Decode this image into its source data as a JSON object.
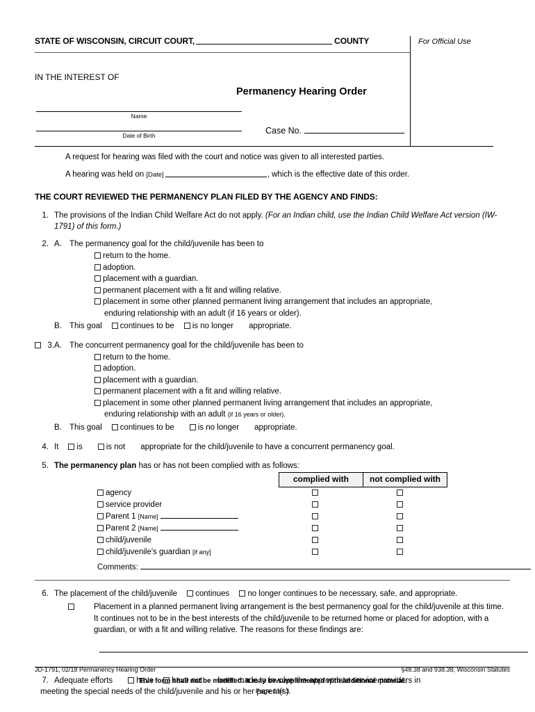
{
  "header": {
    "court_label": "STATE OF WISCONSIN, CIRCUIT COURT,",
    "county_label": "COUNTY",
    "in_the_interest_of": "IN THE INTEREST OF",
    "form_title": "Permanency Hearing Order",
    "name_caption": "Name",
    "dob_caption": "Date of Birth",
    "case_no_label": "Case No.",
    "official_use": "For Official Use"
  },
  "intro": {
    "request": "A request for hearing was filed with the court and notice was given to all interested parties.",
    "hearing_prefix": "A hearing was held on",
    "hearing_date_tag": "[Date]",
    "hearing_suffix": ", which is the effective date of this order."
  },
  "court_finds_heading": "THE COURT REVIEWED THE PERMANENCY PLAN FILED BY THE AGENCY AND FINDS:",
  "items": {
    "i1": {
      "num": "1.",
      "text": "The provisions of the Indian Child Welfare Act do not apply.",
      "italic_note": "(For an Indian child, use the Indian Child Welfare Act version (IW-1791) of this form.)"
    },
    "i2": {
      "num": "2.",
      "sub_a": "A.",
      "a_text": "The permanency goal for the child/juvenile has been to",
      "options": [
        "return to the home.",
        "adoption.",
        "placement with a guardian.",
        "permanent placement with a fit and willing relative.",
        "placement in some other planned permanent living arrangement that includes an appropriate,"
      ],
      "option5_cont": "enduring relationship with an adult (if 16 years or older).",
      "sub_b": "B.",
      "b_prefix": "This goal",
      "b_opt1": "continues to be",
      "b_opt2": "is no longer",
      "b_suffix": "appropriate."
    },
    "i3": {
      "num": "3.",
      "sub_a": "A.",
      "a_text": "The concurrent permanency goal for the child/juvenile has been to",
      "options": [
        "return to the home.",
        "adoption.",
        "placement with a guardian.",
        "permanent placement with a fit and willing relative.",
        "placement in some other planned permanent living arrangement that includes an appropriate,"
      ],
      "option5_cont_main": "enduring relationship with an adult",
      "option5_cont_small": "(if 16 years or older).",
      "sub_b": "B.",
      "b_prefix": "This goal",
      "b_opt1": "continues to be",
      "b_opt2": "is no longer",
      "b_suffix": "appropriate."
    },
    "i4": {
      "num": "4.",
      "prefix": "It",
      "opt1": "is",
      "opt2": "is not",
      "suffix": "appropriate for the child/juvenile to have a concurrent permanency goal."
    },
    "i5": {
      "num": "5.",
      "bold_lead": "The permanency plan",
      "text": "has or has not been complied with as follows:",
      "col_a": "complied with",
      "col_b": "not complied with",
      "rows": [
        {
          "label": "agency",
          "name_tag": "",
          "has_blank": false
        },
        {
          "label": "service provider",
          "name_tag": "",
          "has_blank": false
        },
        {
          "label": "Parent 1",
          "name_tag": "[Name]",
          "has_blank": true
        },
        {
          "label": "Parent 2",
          "name_tag": "[Name]",
          "has_blank": true
        },
        {
          "label": "child/juvenile",
          "name_tag": "",
          "has_blank": false
        },
        {
          "label": "child/juvenile's guardian",
          "name_tag": "[if any]",
          "has_blank": false
        }
      ],
      "comments_label": "Comments:"
    },
    "i6": {
      "num": "6.",
      "prefix": "The placement of the child/juvenile",
      "opt1": "continues",
      "opt2": "no longer continues to be necessary, safe, and appropriate.",
      "paragraph": "Placement in a planned permanent living arrangement is the best permanency goal for the child/juvenile at this time. It continues not to be in the best interests of the child/juvenile to be returned home or placed for adoption, with a guardian, or with a fit and willing relative. The reasons for these findings are:"
    },
    "i7": {
      "num": "7.",
      "prefix": "Adequate efforts",
      "opt1": "have",
      "opt2": "have not",
      "suffix": "been made to involve the appropriate service providers in",
      "line2": "meeting the special needs of the child/juvenile and his or her parent(s)."
    }
  },
  "footer": {
    "left": "JD-1791, 02/18  Permanency Hearing Order",
    "right": "§48.38 and 938.38, Wisconsin Statutes",
    "center": "This form shall not be modified. It may be supplemented with additional material.",
    "page": "Page 1 of 3"
  }
}
